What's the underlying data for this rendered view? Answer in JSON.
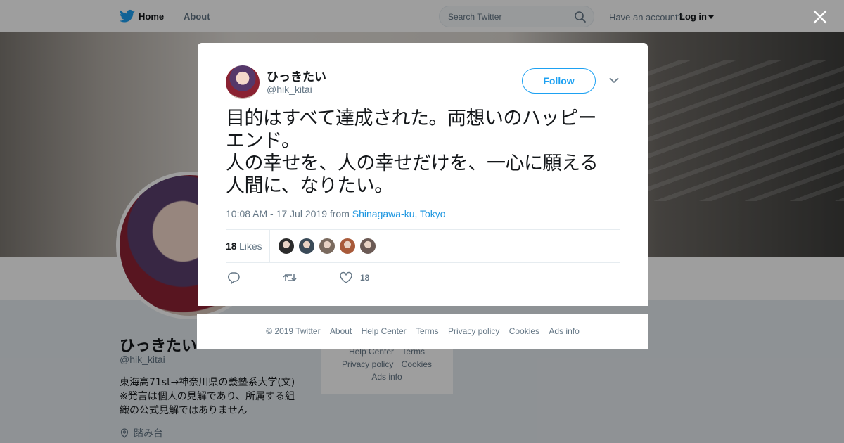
{
  "topbar": {
    "home_label": "Home",
    "about_label": "About",
    "search_placeholder": "Search Twitter",
    "have_account": "Have an account?",
    "login_label": "Log in"
  },
  "profile": {
    "name": "ひっきたい",
    "handle": "@hik_kitai",
    "bio_lines": [
      "東海高71st→神奈川県の義塾系大学(文)",
      "※発言は個人の見解であり、所属する組",
      "織の公式見解ではありません"
    ],
    "location": "踏み台"
  },
  "background_footer": {
    "row1": [
      "Help Center",
      "Terms"
    ],
    "row2": [
      "Privacy policy",
      "Cookies"
    ],
    "row3": [
      "Ads info"
    ]
  },
  "tweet": {
    "name": "ひっきたい",
    "handle": "@hik_kitai",
    "follow_label": "Follow",
    "text_lines": [
      "目的はすべて達成された。両想いのハッピー",
      "エンド。",
      "人の幸せを、人の幸せだけを、一心に願える",
      "人間に、なりたい。"
    ],
    "timestamp": "10:08 AM - 17 Jul 2019 from",
    "location_link": "Shinagawa-ku, Tokyo",
    "likes_count": "18",
    "likes_label": "Likes",
    "action_like_count": "18",
    "liker_colors": [
      "#2b2b2b",
      "#3a4a58",
      "#7a6a5e",
      "#a85a3a",
      "#6b5a55"
    ]
  },
  "modal_footer": {
    "links": [
      "© 2019 Twitter",
      "About",
      "Help Center",
      "Terms",
      "Privacy policy",
      "Cookies",
      "Ads info"
    ]
  },
  "colors": {
    "accent": "#1da1f2",
    "link": "#1b95e0",
    "secondary_text": "#657786"
  }
}
